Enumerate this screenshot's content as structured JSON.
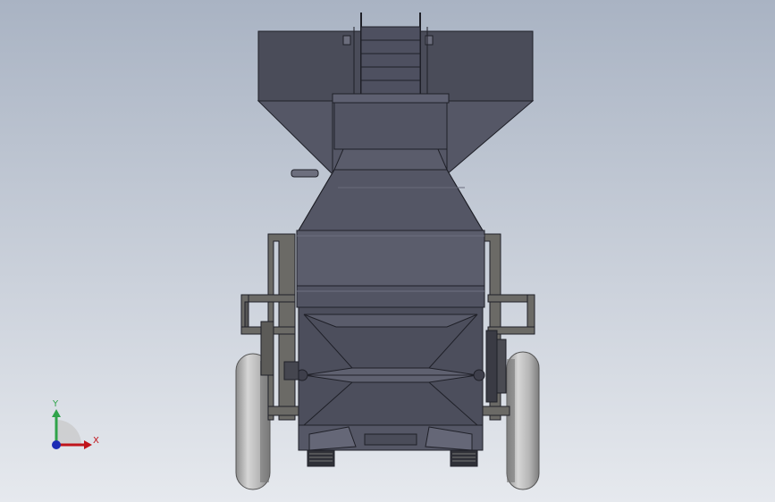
{
  "viewport": {
    "background_top": "#a9b3c3",
    "background_bottom": "#e6e9ee"
  },
  "model": {
    "body_color": "#4f5160",
    "body_light": "#5e6071",
    "frame_color": "#6b6a66",
    "wheel_color": "#c9c9c9"
  },
  "triad": {
    "x_label": "X",
    "y_label": "Y",
    "x_color": "#c0141b",
    "y_color": "#2fa34a",
    "z_color": "#1d2bb5"
  }
}
